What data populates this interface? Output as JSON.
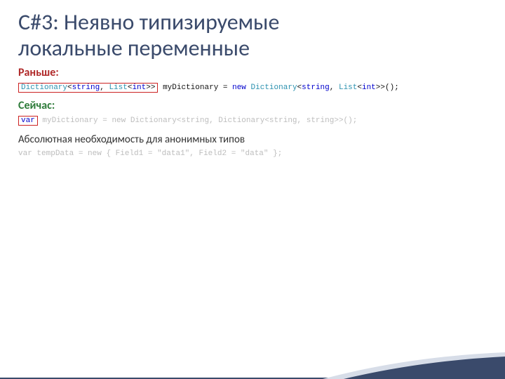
{
  "title_line1": "C#3: Неявно типизируемые",
  "title_line2": "локальные переменные",
  "section_before": "Раньше:",
  "section_now": "Сейчас:",
  "section_note": "Абсолютная необходимость для анонимных типов",
  "code1": {
    "boxed_type": "Dictionary",
    "boxed_generic_open": "<",
    "boxed_string": "string",
    "boxed_comma": ", ",
    "boxed_list": "List",
    "boxed_int_open": "<",
    "boxed_int": "int",
    "boxed_close": ">>",
    "var_space": " ",
    "var_name": "myDictionary = ",
    "kw_new": "new",
    "sp1": " ",
    "type2": "Dictionary",
    "gen2_open": "<",
    "str2": "string",
    "comma2": ", ",
    "list2": "List",
    "int2_open": "<",
    "int2": "int",
    "close2": ">>();"
  },
  "code2": {
    "box_var": "var",
    "rest_pre": " myDictionary = ",
    "kw_new": "new",
    "sp": " ",
    "type": "Dictionary",
    "open": "<",
    "str1": "string",
    "c1": ", ",
    "dict2": "Dictionary",
    "open2": "<",
    "str2": "string",
    "c2": ", ",
    "str3": "string",
    "close": ">>();"
  },
  "code3": {
    "kw_var": "var",
    "pre": " tempData = ",
    "kw_new": "new",
    "brace": " { Field1 = ",
    "s1": "\"data1\"",
    "mid": ", Field2 = ",
    "s2": "\"data\"",
    "end": " };"
  }
}
